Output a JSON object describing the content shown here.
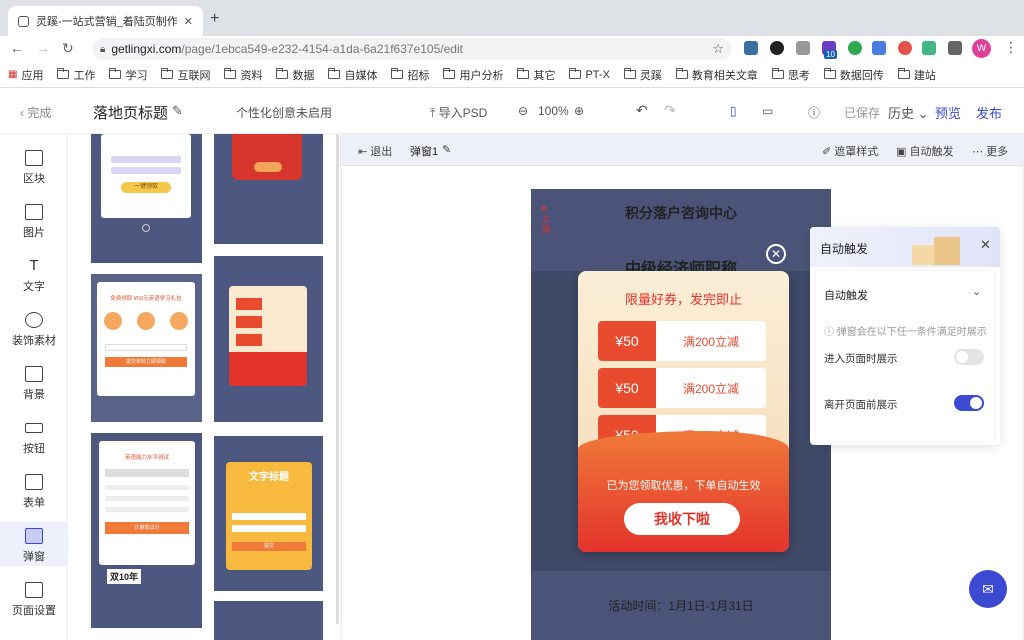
{
  "browser": {
    "tab_title": "灵蹊-一站式营销_着陆页制作_图",
    "url_domain": "getlingxi.com",
    "url_path": "/page/1ebca549-e232-4154-a1da-6a21f637e105/edit",
    "profile_letter": "W",
    "ext_badge": "10"
  },
  "bookmarks": [
    "应用",
    "工作",
    "学习",
    "互联网",
    "资料",
    "数据",
    "自媒体",
    "招标",
    "用户分析",
    "其它",
    "PT-X",
    "灵蹊",
    "教育相关文章",
    "思考",
    "数据回传",
    "建站"
  ],
  "header": {
    "done": "完成",
    "page_title": "落地页标题",
    "ideas": "个性化创意未启用",
    "import": "导入PSD",
    "zoom": "100%",
    "saved": "已保存",
    "history": "历史",
    "preview": "预览",
    "publish": "发布"
  },
  "left_nav": [
    {
      "label": "区块"
    },
    {
      "label": "图片"
    },
    {
      "label": "文字"
    },
    {
      "label": "装饰素材"
    },
    {
      "label": "背景"
    },
    {
      "label": "按钮"
    },
    {
      "label": "表单"
    },
    {
      "label": "弹窗",
      "active": true
    },
    {
      "label": "页面设置"
    }
  ],
  "templates": {
    "t1_btn": "一键领取",
    "t3_title": "免费领取 ¥50元英语学习礼包",
    "t3_btn": "提交资料立即领取",
    "t5_title": "英语能力水平测试",
    "t5_btn": "计算笔试分",
    "t5_foot": "双10年",
    "t6_title": "文字标题",
    "t6_btn": "提交"
  },
  "canvas_toolbar": {
    "exit": "退出",
    "popup_name": "弹窗1",
    "mask_style": "遮罩样式",
    "auto_trigger": "自动触发",
    "more": "更多"
  },
  "phone": {
    "location": "上海",
    "center": "积分落户咨询中心",
    "headline": "中级经济师职称",
    "activity": "活动时间：1月1日-1月31日"
  },
  "popup": {
    "title": "限量好券，发完即止",
    "coupons": [
      {
        "amount": "¥50",
        "desc": "满200立减"
      },
      {
        "amount": "¥50",
        "desc": "满200立减"
      },
      {
        "amount": "¥50",
        "desc": "满200立减"
      }
    ],
    "note": "已为您领取优惠，下单自动生效",
    "button": "我收下啦"
  },
  "trigger_panel": {
    "title": "自动触发",
    "section": "自动触发",
    "hint": "弹窗会在以下任一条件满足时展示",
    "on_enter_label": "进入页面时展示",
    "on_enter": false,
    "on_leave_label": "离开页面前展示",
    "on_leave": true
  },
  "colors": {
    "accent": "#3b4ad0",
    "coupon_red": "#e84b2e",
    "phone_bg": "#4b5478"
  }
}
